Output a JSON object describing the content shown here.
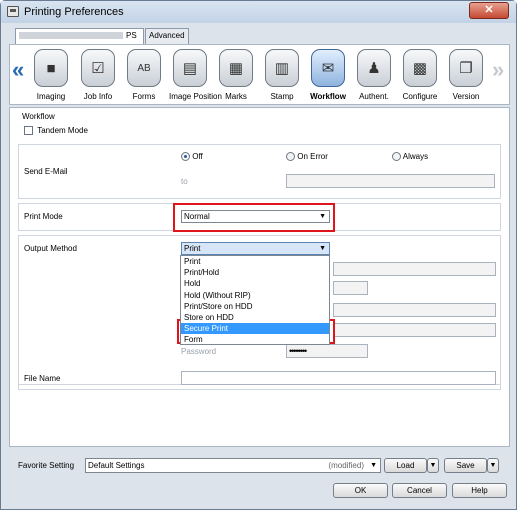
{
  "window": {
    "title": "Printing Preferences",
    "close_glyph": "✕"
  },
  "tabs": [
    {
      "label": "PS"
    },
    {
      "label": "Advanced"
    }
  ],
  "toolbar": {
    "left_arrow": "«",
    "right_arrow": "»",
    "items": [
      {
        "label": "Imaging",
        "icon": "imaging-icon",
        "glyph": "■"
      },
      {
        "label": "Job Info",
        "icon": "job-info-icon",
        "glyph": "☑"
      },
      {
        "label": "Forms",
        "icon": "forms-icon",
        "glyph": "AB"
      },
      {
        "label": "Image Position",
        "icon": "image-position-icon",
        "glyph": "▤"
      },
      {
        "label": "Marks",
        "icon": "marks-icon",
        "glyph": "▦"
      },
      {
        "label": "Stamp",
        "icon": "stamp-icon",
        "glyph": "▥"
      },
      {
        "label": "Workflow",
        "icon": "workflow-icon",
        "glyph": "✉"
      },
      {
        "label": "Authent.",
        "icon": "authentication-icon",
        "glyph": "♟"
      },
      {
        "label": "Configure",
        "icon": "configure-icon",
        "glyph": "▩"
      },
      {
        "label": "Version",
        "icon": "version-icon",
        "glyph": "❐"
      }
    ],
    "selected": "Workflow"
  },
  "workflow": {
    "section_title": "Workflow",
    "tandem_mode": {
      "label": "Tandem Mode",
      "checked": false
    },
    "send_email": {
      "label": "Send E-Mail",
      "options": [
        {
          "label": "Off",
          "selected": true
        },
        {
          "label": "On Error",
          "selected": false
        },
        {
          "label": "Always",
          "selected": false
        }
      ],
      "to_label": "to",
      "to_value": ""
    },
    "print_mode": {
      "label": "Print Mode",
      "value": "Normal"
    },
    "output_method": {
      "label": "Output Method",
      "value": "Print",
      "options": [
        "Print",
        "Print/Hold",
        "Hold",
        "Hold (Without RIP)",
        "Print/Store on HDD",
        "Store on HDD",
        "Secure Print",
        "Form"
      ],
      "highlighted": "Secure Print"
    },
    "password": {
      "label": "Password",
      "value": "••••••••"
    },
    "file_name": {
      "label": "File Name",
      "value": ""
    }
  },
  "footer": {
    "favorite_label": "Favorite Setting",
    "favorite_value": "Default Settings",
    "modified_text": "(modified)",
    "load_label": "Load",
    "save_label": "Save",
    "ok_label": "OK",
    "cancel_label": "Cancel",
    "help_label": "Help"
  },
  "colors": {
    "highlight_box": "#e0151c",
    "selected_option": "#3399ff"
  }
}
